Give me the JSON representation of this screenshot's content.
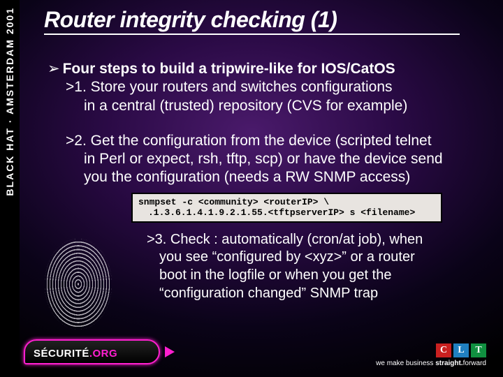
{
  "left_banner": "BLACK HAT · AMSTERDAM 2001",
  "title": "Router integrity checking (1)",
  "heading_arrow": "➢",
  "heading": "Four steps to build a tripwire-like for IOS/CatOS",
  "step1_a": ">1. Store your routers and switches configurations",
  "step1_b": "in a central (trusted) repository (CVS for example)",
  "step2_a": ">2. Get the configuration from the device (scripted telnet",
  "step2_b": "in Perl or expect, rsh, tftp, scp) or have the device send",
  "step2_c": "you the configuration (needs a RW SNMP access)",
  "code_line1": "snmpset -c <community> <routerIP> \\",
  "code_line2": ".1.3.6.1.4.1.9.2.1.55.<tftpserverIP> s <filename>",
  "step3_a": ">3. Check : automatically (cron/at job), when",
  "step3_b": "you see “configured by <xyz>” or a router",
  "step3_c": "boot in the logfile or when you get the",
  "step3_d": "“configuration changed” SNMP trap",
  "securite_brand": "SÉCURITÉ",
  "securite_suffix": ".ORG",
  "clt": {
    "c": "C",
    "l": "L",
    "t": "T"
  },
  "tagline_pre": "we make business ",
  "tagline_bold": "straight.",
  "tagline_post": "forward"
}
